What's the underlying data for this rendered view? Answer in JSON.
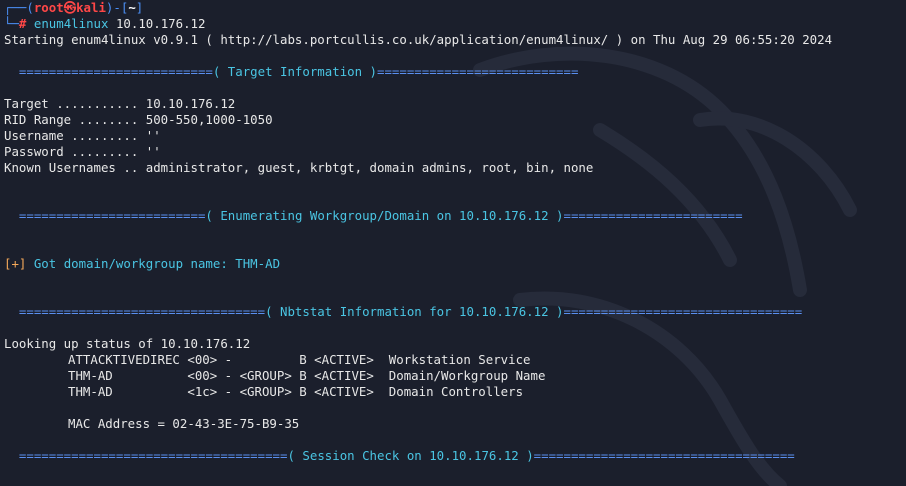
{
  "prompt": {
    "frame_top": "┌──(",
    "user": "root",
    "at_symbol": "㉿",
    "host": "kali",
    "frame_mid": ")-[",
    "dir": "~",
    "frame_end": "]",
    "frame_bottom": "└─",
    "hash": "#",
    "command": "enum4linux",
    "argument": "10.10.176.12"
  },
  "starting_line": "Starting enum4linux v0.9.1 ( http://labs.portcullis.co.uk/application/enum4linux/ ) on Thu Aug 29 06:55:20 2024",
  "sections": {
    "target_info": {
      "rule_left": "  ==========================",
      "title": "( Target Information )",
      "rule_right": "==========================="
    },
    "workgroup": {
      "rule_left": "  =========================",
      "title": "( Enumerating Workgroup/Domain on 10.10.176.12 )",
      "rule_right": "========================"
    },
    "nbtstat": {
      "rule_left": "  =================================",
      "title": "( Nbtstat Information for 10.10.176.12 )",
      "rule_right": "================================"
    },
    "session": {
      "rule_left": "  ====================================",
      "title": "( Session Check on 10.10.176.12 )",
      "rule_right": "==================================="
    }
  },
  "target_info": {
    "target": "Target ........... 10.10.176.12",
    "rid_range": "RID Range ........ 500-550,1000-1050",
    "username": "Username ......... ''",
    "password": "Password ......... ''",
    "known_usernames": "Known Usernames .. administrator, guest, krbtgt, domain admins, root, bin, none"
  },
  "workgroup_result": {
    "bracket": "[+]",
    "text": " Got domain/workgroup name: THM-AD"
  },
  "nbtstat": {
    "looking_up": "Looking up status of 10.10.176.12",
    "rows": [
      "ATTACKTIVEDIREC <00> -         B <ACTIVE>  Workstation Service",
      "THM-AD          <00> - <GROUP> B <ACTIVE>  Domain/Workgroup Name",
      "THM-AD          <1c> - <GROUP> B <ACTIVE>  Domain Controllers"
    ],
    "mac": "MAC Address = 02-43-3E-75-B9-35"
  },
  "colors": {
    "background": "#1b1f2c",
    "text": "#e8e8e8",
    "cyan": "#4ac5e3",
    "blue_rule": "#5a8ff0",
    "red_prompt": "#ff4747",
    "orange_bracket": "#f5a95a"
  }
}
